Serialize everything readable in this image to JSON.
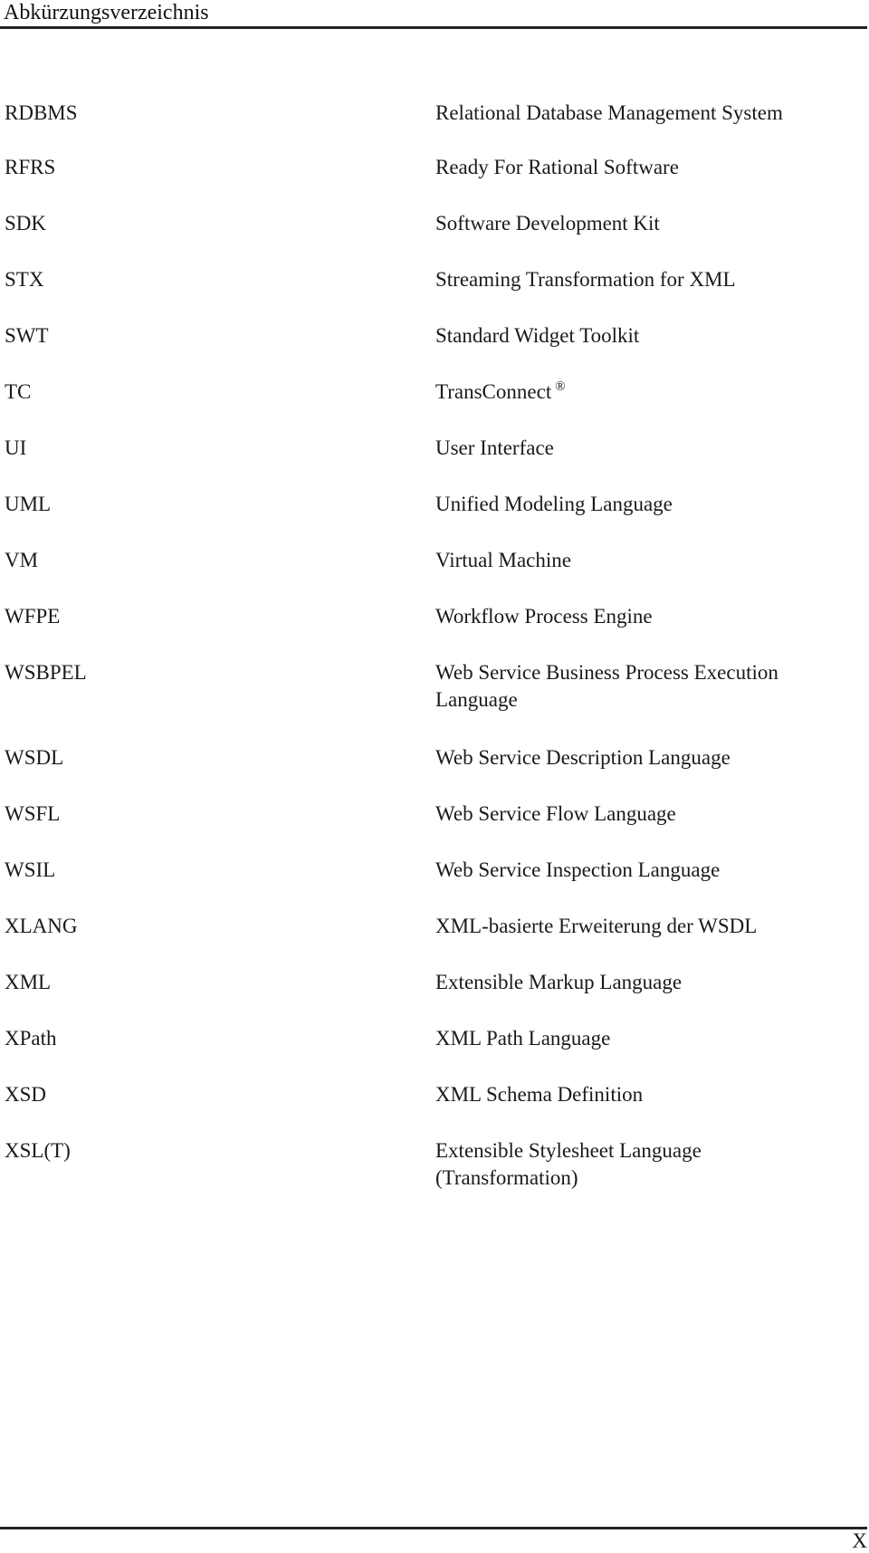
{
  "header": {
    "title": "Abkürzungsverzeichnis"
  },
  "entries": [
    {
      "abbr": "RDBMS",
      "definition": "Relational Database Management System"
    },
    {
      "abbr": "RFRS",
      "definition": "Ready For Rational Software"
    },
    {
      "abbr": "SDK",
      "definition": "Software Development Kit"
    },
    {
      "abbr": "STX",
      "definition": "Streaming Transformation for XML"
    },
    {
      "abbr": "SWT",
      "definition": "Standard Widget Toolkit"
    },
    {
      "abbr": "TC",
      "definition": "TransConnect",
      "mark": "®"
    },
    {
      "abbr": "UI",
      "definition": "User Interface"
    },
    {
      "abbr": "UML",
      "definition": "Unified Modeling Language"
    },
    {
      "abbr": "VM",
      "definition": "Virtual Machine"
    },
    {
      "abbr": "WFPE",
      "definition": "Workflow Process Engine"
    },
    {
      "abbr": "WSBPEL",
      "definition": "Web Service Business Process Execution Language"
    },
    {
      "abbr": "WSDL",
      "definition": "Web Service Description Language"
    },
    {
      "abbr": "WSFL",
      "definition": "Web Service Flow Language"
    },
    {
      "abbr": "WSIL",
      "definition": "Web Service Inspection Language"
    },
    {
      "abbr": "XLANG",
      "definition": "XML-basierte Erweiterung der WSDL"
    },
    {
      "abbr": "XML",
      "definition": "Extensible Markup Language"
    },
    {
      "abbr": "XPath",
      "definition": "XML Path Language"
    },
    {
      "abbr": "XSD",
      "definition": "XML Schema Definition"
    },
    {
      "abbr": "XSL(T)",
      "definition": "Extensible Stylesheet Language (Transformation)"
    }
  ],
  "footer": {
    "page_number": "X"
  }
}
